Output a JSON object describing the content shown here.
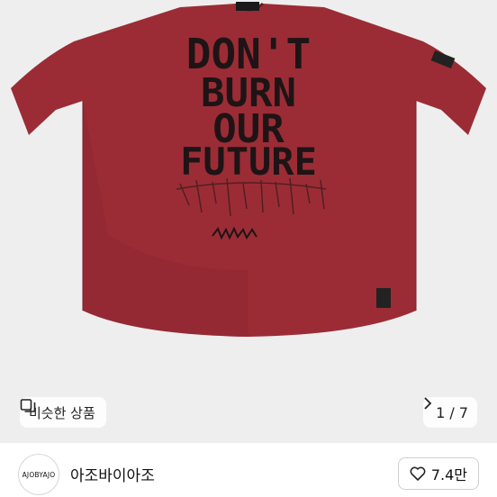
{
  "product": {
    "print_lines": [
      "DON'T",
      "BURN",
      "OUR",
      "FUTURE"
    ],
    "image_bg": "#eeeeee",
    "shirt_color": "#9b2c35",
    "ink_color": "#1e1416"
  },
  "overlay": {
    "similar_label": "비슷한 상품",
    "similar_icon": "similar-items-icon",
    "pager_text": "1 / 7",
    "pager_icon": "chevron-right-icon"
  },
  "seller": {
    "avatar_text": "AJOBYAJO",
    "name": "아조바이아조",
    "likes": "7.4만",
    "like_icon": "heart-icon"
  }
}
